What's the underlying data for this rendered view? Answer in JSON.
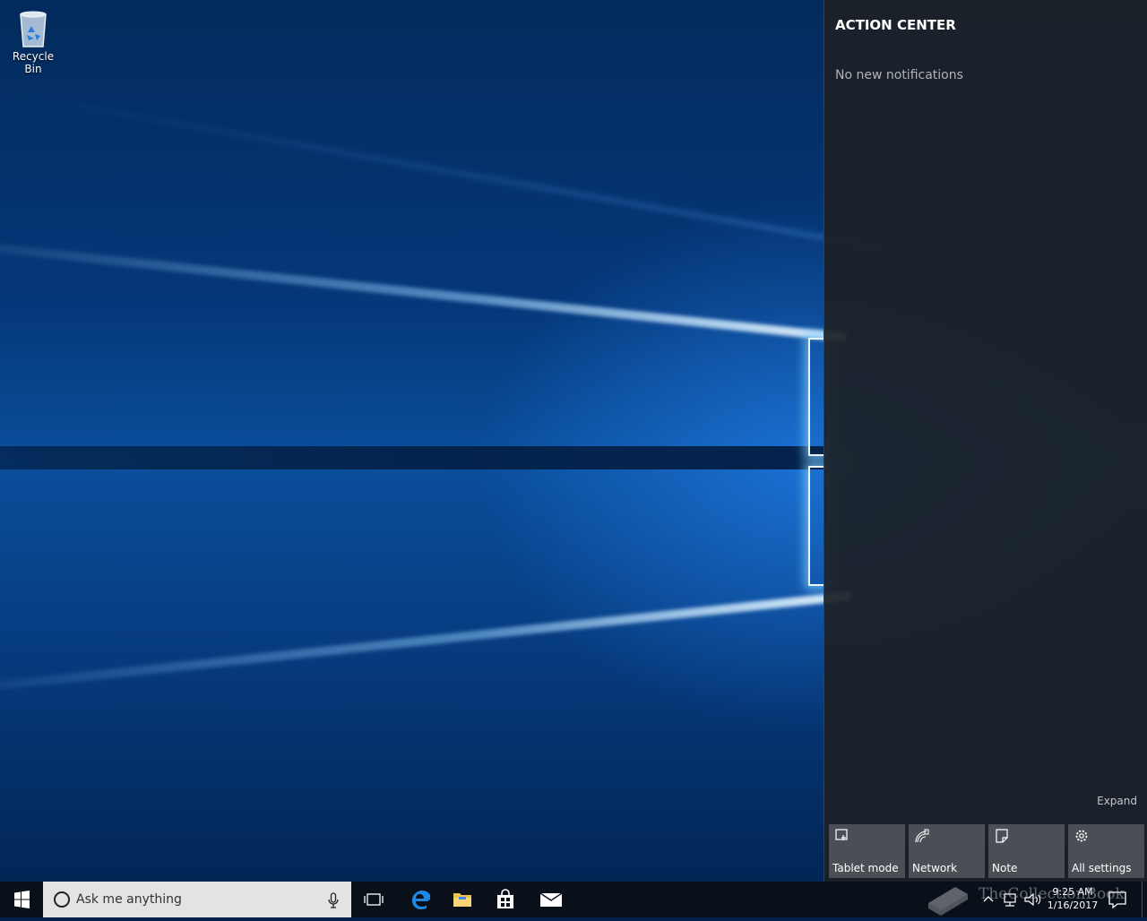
{
  "desktop": {
    "icons": [
      {
        "label": "Recycle Bin",
        "icon": "recycle-bin-icon"
      }
    ]
  },
  "action_center": {
    "title": "ACTION CENTER",
    "empty_message": "No new notifications",
    "expand_label": "Expand",
    "quick_actions": [
      {
        "label": "Tablet mode",
        "icon": "tablet-mode-icon"
      },
      {
        "label": "Network",
        "icon": "network-icon"
      },
      {
        "label": "Note",
        "icon": "note-icon"
      },
      {
        "label": "All settings",
        "icon": "gear-icon"
      }
    ]
  },
  "taskbar": {
    "search_placeholder": "Ask me anything",
    "pinned": [
      {
        "name": "Task View",
        "icon": "task-view-icon"
      },
      {
        "name": "Microsoft Edge",
        "icon": "edge-icon"
      },
      {
        "name": "File Explorer",
        "icon": "file-explorer-icon"
      },
      {
        "name": "Store",
        "icon": "store-icon"
      },
      {
        "name": "Mail",
        "icon": "mail-icon"
      }
    ],
    "clock": {
      "time": "9:25 AM",
      "date": "1/16/2017"
    }
  },
  "watermark": {
    "text": "TheCollectionBook"
  },
  "colors": {
    "accent": "#0078d7",
    "taskbar_bg": "#0a1019",
    "action_center_bg": "#1c2026",
    "tile_bg": "#4b4f55"
  }
}
